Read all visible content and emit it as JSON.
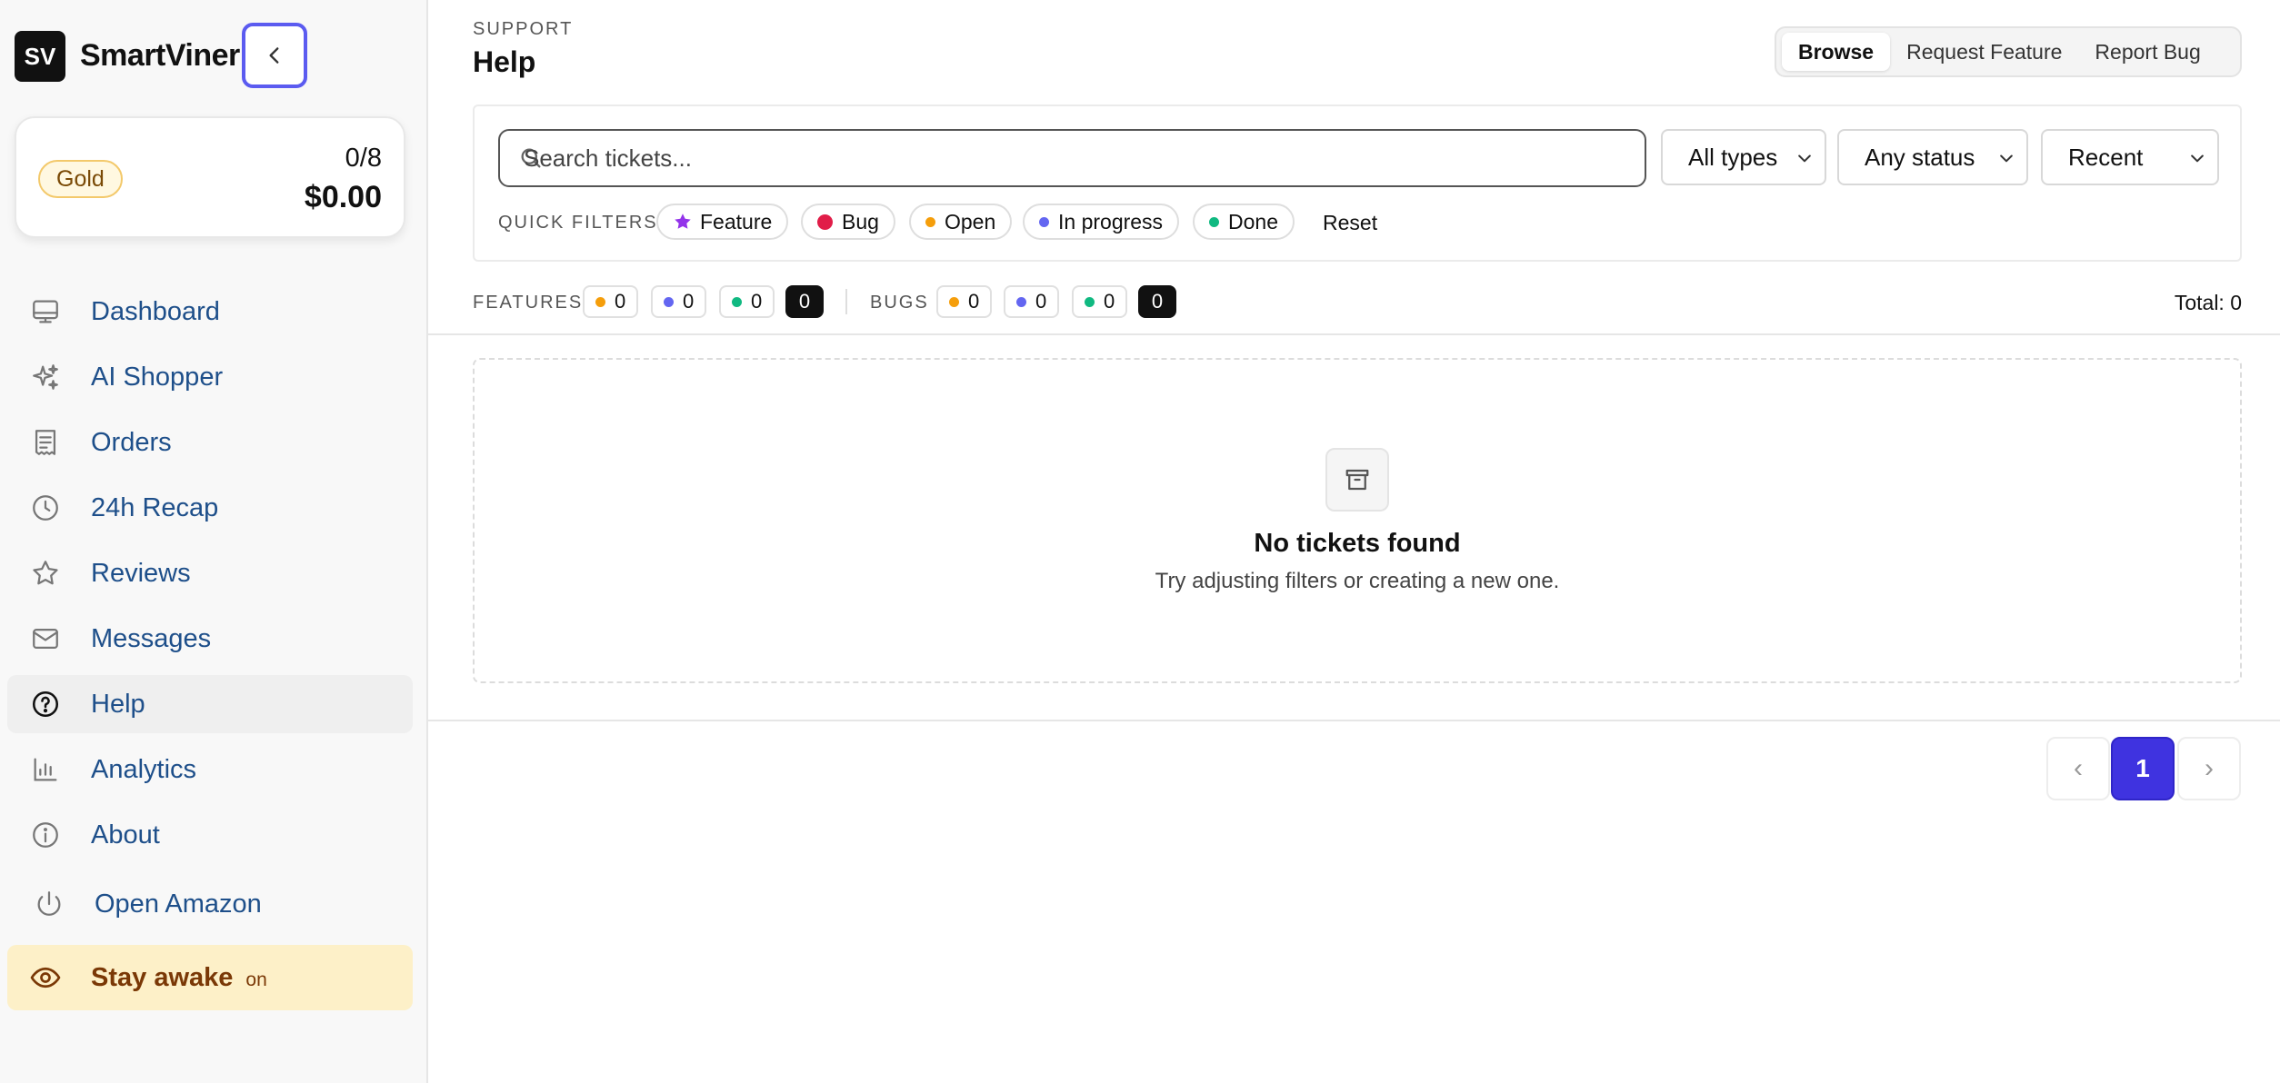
{
  "sidebar": {
    "logo": "SV",
    "app_name": "SmartViner",
    "plan": {
      "tier": "Gold",
      "count": "0/8",
      "amount": "$0.00"
    },
    "items": [
      {
        "label": "Dashboard",
        "icon": "monitor-icon"
      },
      {
        "label": "AI Shopper",
        "icon": "sparkles-icon"
      },
      {
        "label": "Orders",
        "icon": "receipt-icon"
      },
      {
        "label": "24h Recap",
        "icon": "clock-icon"
      },
      {
        "label": "Reviews",
        "icon": "star-icon"
      },
      {
        "label": "Messages",
        "icon": "mail-icon"
      },
      {
        "label": "Help",
        "icon": "help-circle-icon",
        "active": true
      },
      {
        "label": "Analytics",
        "icon": "bar-chart-icon"
      },
      {
        "label": "About",
        "icon": "info-icon"
      },
      {
        "label": "Open Amazon",
        "icon": "power-icon"
      }
    ],
    "stay_awake": {
      "label": "Stay awake",
      "state": "on",
      "icon": "eye-icon"
    }
  },
  "header": {
    "eyebrow": "SUPPORT",
    "title": "Help",
    "tabs": [
      {
        "label": "Browse",
        "active": true
      },
      {
        "label": "Request Feature"
      },
      {
        "label": "Report Bug"
      }
    ]
  },
  "filters": {
    "search_placeholder": "Search tickets...",
    "search_value": "",
    "type_select": "All types",
    "status_select": "Any status",
    "sort_select": "Recent",
    "quick_label": "QUICK FILTERS",
    "quick": [
      {
        "label": "Feature",
        "icon": "star-icon"
      },
      {
        "label": "Bug"
      },
      {
        "label": "Open"
      },
      {
        "label": "In progress"
      },
      {
        "label": "Done"
      }
    ],
    "reset_label": "Reset"
  },
  "stats": {
    "features_label": "FEATURES",
    "features": [
      "0",
      "0",
      "0",
      "0"
    ],
    "bugs_label": "BUGS",
    "bugs": [
      "0",
      "0",
      "0",
      "0"
    ],
    "total": "Total: 0"
  },
  "empty": {
    "icon": "archive-icon",
    "title": "No tickets found",
    "subtitle": "Try adjusting filters or creating a new one."
  },
  "pagination": {
    "prev": "‹",
    "current": "1",
    "next": "›"
  },
  "colors": {
    "accent": "#3f33e0",
    "focus_ring": "#5b5bf0",
    "orange": "#f59e0b",
    "indigo": "#6366f1",
    "green": "#10b981",
    "red": "#e11d48",
    "purple": "#9333ea",
    "link": "#1e4f8a",
    "stay_bg": "#fdf0c8"
  }
}
